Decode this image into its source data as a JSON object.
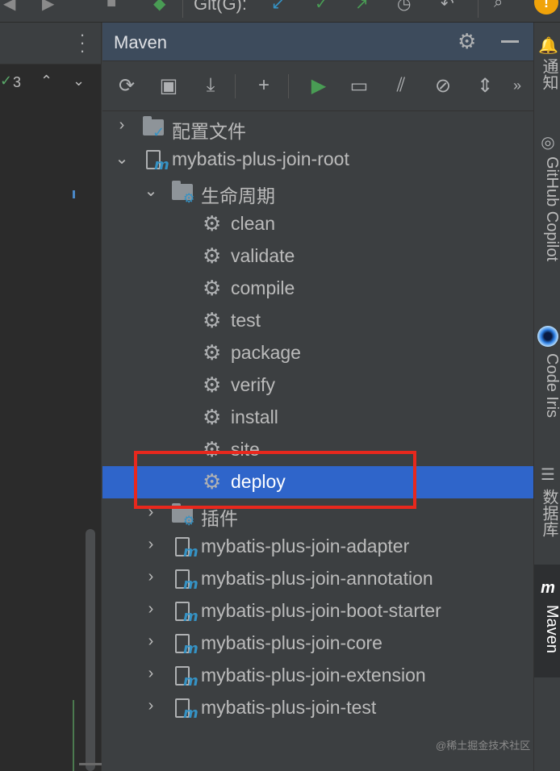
{
  "top_toolbar": {
    "git_label": "Git(G):"
  },
  "editor_strip": {
    "problem_count": "3"
  },
  "maven": {
    "title": "Maven",
    "toolbar": [
      {
        "name": "reload-icon",
        "glyph": "⟳"
      },
      {
        "name": "generate-sources-icon",
        "glyph": "▣"
      },
      {
        "name": "download-icon",
        "glyph": "⤓"
      },
      {
        "name": "add-icon",
        "glyph": "+"
      },
      {
        "name": "run-icon",
        "glyph": "▶"
      },
      {
        "name": "execute-goal-icon",
        "glyph": "▭"
      },
      {
        "name": "toggle-offline-icon",
        "glyph": "⫽"
      },
      {
        "name": "skip-tests-icon",
        "glyph": "⊘"
      },
      {
        "name": "collapse-all-icon",
        "glyph": "⇕"
      },
      {
        "name": "more-icon",
        "glyph": "»"
      }
    ],
    "tree": {
      "profiles_label": "配置文件",
      "root_label": "mybatis-plus-join-root",
      "lifecycle_label": "生命周期",
      "lifecycle_goals": [
        "clean",
        "validate",
        "compile",
        "test",
        "package",
        "verify",
        "install",
        "site",
        "deploy"
      ],
      "selected_goal": "deploy",
      "plugins_label": "插件",
      "modules": [
        "mybatis-plus-join-adapter",
        "mybatis-plus-join-annotation",
        "mybatis-plus-join-boot-starter",
        "mybatis-plus-join-core",
        "mybatis-plus-join-extension",
        "mybatis-plus-join-test"
      ]
    }
  },
  "right_sidebar": {
    "tabs": [
      {
        "label": "通知"
      },
      {
        "label": "GitHub Copilot"
      },
      {
        "label": "Code Iris"
      },
      {
        "label": "数据库"
      },
      {
        "label": "Maven",
        "active": true
      }
    ]
  },
  "watermark": "@稀土掘金技术社区",
  "colors": {
    "selection": "#2f65ca",
    "highlight_box": "#e8281d",
    "header": "#3d4b5c",
    "panel": "#3c3f41",
    "run_green": "#499c54",
    "maven_blue": "#3592c4"
  }
}
